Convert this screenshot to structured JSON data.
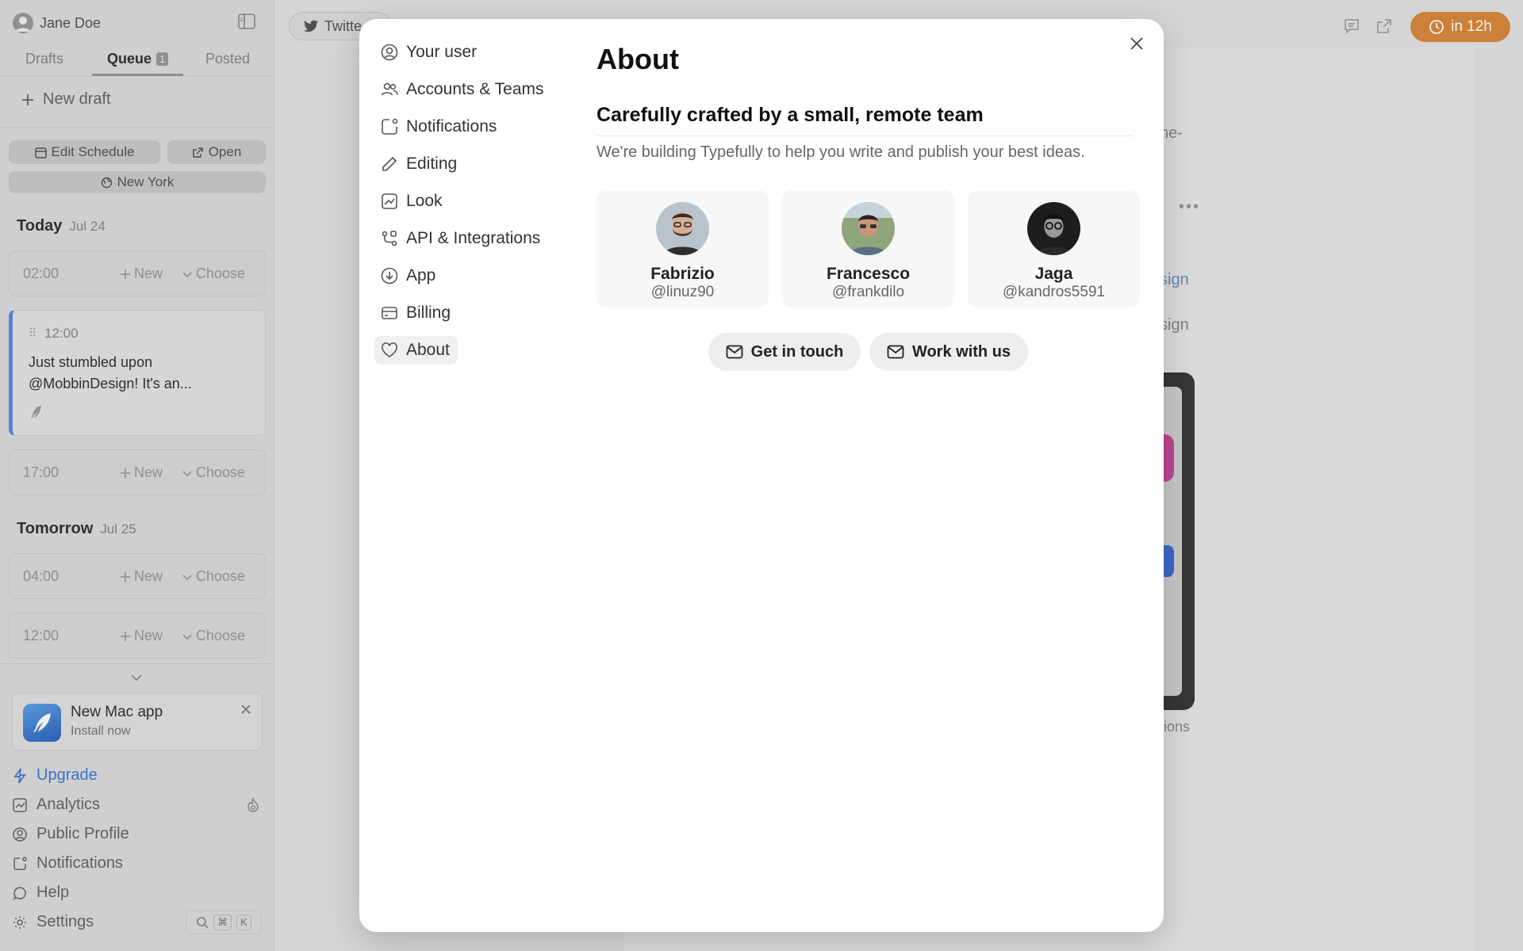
{
  "sidebar": {
    "user_name": "Jane Doe",
    "tabs": {
      "drafts": "Drafts",
      "queue": "Queue",
      "queue_count": "1",
      "posted": "Posted"
    },
    "new_draft": "New draft",
    "edit_schedule": "Edit Schedule",
    "open": "Open",
    "timezone": "New York",
    "today": {
      "name": "Today",
      "date": "Jul 24"
    },
    "tomorrow": {
      "name": "Tomorrow",
      "date": "Jul 25"
    },
    "slot_new": "New",
    "slot_choose": "Choose",
    "slots": {
      "today_1": "02:00",
      "today_3": "17:00",
      "tomorrow_1": "04:00",
      "tomorrow_2": "12:00"
    },
    "post": {
      "time": "12:00",
      "text": "Just stumbled upon @MobbinDesign! It's an..."
    },
    "mac_app": {
      "title": "New Mac app",
      "subtitle": "Install now"
    },
    "nav": {
      "upgrade": "Upgrade",
      "analytics": "Analytics",
      "public_profile": "Public Profile",
      "notifications": "Notifications",
      "help": "Help",
      "settings": "Settings"
    },
    "shortcut": {
      "cmd": "⌘",
      "key": "K"
    }
  },
  "main": {
    "account_chip": "Twitte",
    "timer": "in 12h",
    "peek": {
      "t1": "ne-",
      "t2": "sign",
      "t3": "sign",
      "t4": "tions"
    }
  },
  "modal": {
    "menu": [
      {
        "label": "Your user",
        "icon": "user-circle-icon"
      },
      {
        "label": "Accounts & Teams",
        "icon": "users-icon"
      },
      {
        "label": "Notifications",
        "icon": "notification-icon"
      },
      {
        "label": "Editing",
        "icon": "pencil-icon"
      },
      {
        "label": "Look",
        "icon": "chart-icon"
      },
      {
        "label": "API & Integrations",
        "icon": "integrations-icon"
      },
      {
        "label": "App",
        "icon": "download-circle-icon"
      },
      {
        "label": "Billing",
        "icon": "credit-card-icon"
      },
      {
        "label": "About",
        "icon": "heart-icon"
      }
    ],
    "title": "About",
    "heading": "Carefully crafted by a small, remote team",
    "subtitle": "We're building Typefully to help you write and publish your best ideas.",
    "team": [
      {
        "name": "Fabrizio",
        "handle": "@linuz90"
      },
      {
        "name": "Francesco",
        "handle": "@frankdilo"
      },
      {
        "name": "Jaga",
        "handle": "@kandros5591"
      }
    ],
    "buttons": {
      "contact": "Get in touch",
      "jobs": "Work with us"
    }
  },
  "colors": {
    "accent": "#3f7ad3",
    "timer": "#d98a3e",
    "post_border": "#5a8fd8"
  }
}
